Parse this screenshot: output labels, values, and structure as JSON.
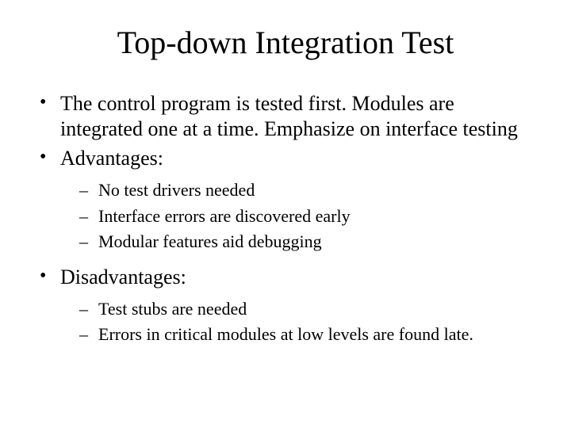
{
  "title": "Top-down Integration Test",
  "bullets": [
    {
      "text": "The control program is tested first. Modules are integrated one at a time. Emphasize on interface testing"
    },
    {
      "text": "Advantages:",
      "sub": [
        "No test drivers needed",
        "Interface errors are discovered early",
        "Modular features aid debugging"
      ]
    },
    {
      "text": "Disadvantages:",
      "sub": [
        "Test stubs are needed",
        "Errors in critical modules at low levels are found late."
      ]
    }
  ]
}
